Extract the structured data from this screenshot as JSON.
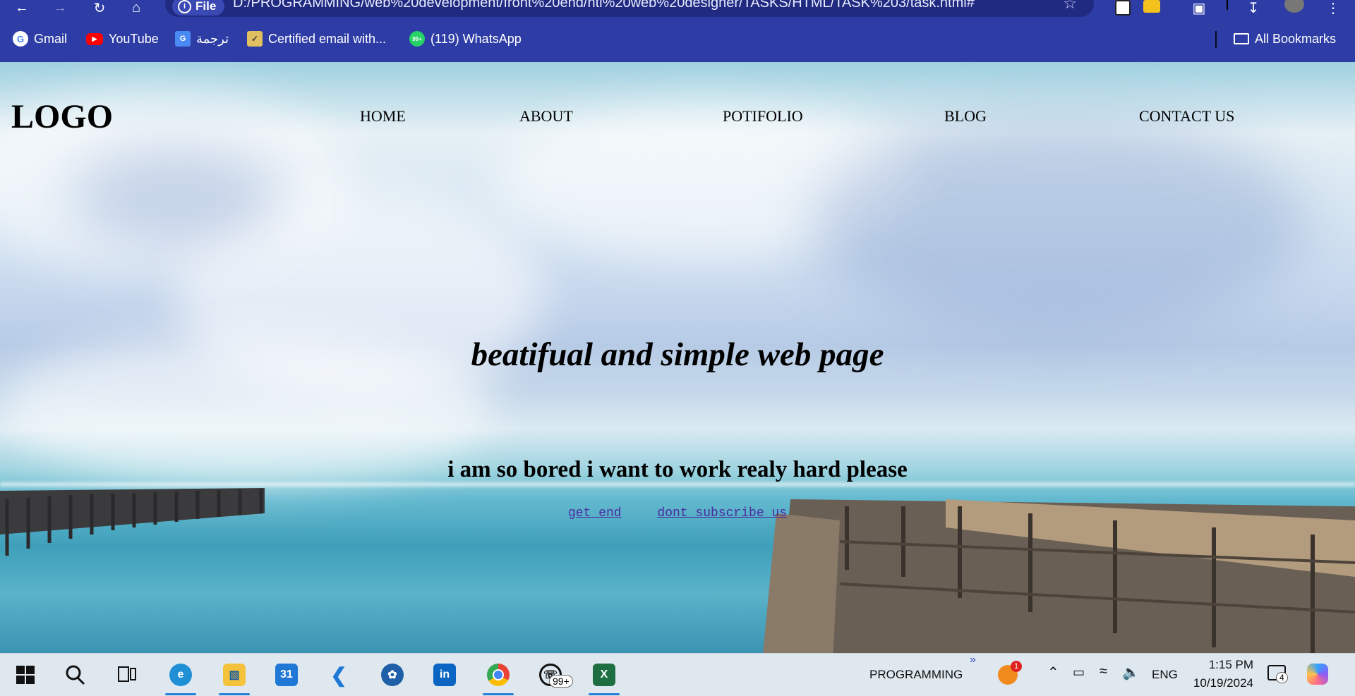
{
  "browser": {
    "url": "D:/PROGRAMMING/web%20development/front%20end/htl%20web%20designer/TASKS/HTML/TASK%203/task.html#",
    "file_chip_label": "File",
    "bookmarks": [
      {
        "label": "Gmail",
        "icon": "google-icon"
      },
      {
        "label": "YouTube",
        "icon": "youtube-icon"
      },
      {
        "label": "ترجمة",
        "icon": "translate-icon"
      },
      {
        "label": "Certified email with...",
        "icon": "certified-email-icon"
      },
      {
        "label": "(119) WhatsApp",
        "icon": "whatsapp-icon"
      }
    ],
    "all_bookmarks_label": "All Bookmarks",
    "whatsapp_badge": "99+"
  },
  "page": {
    "logo": "LOGO",
    "nav": [
      "HOME",
      "ABOUT",
      "POTIFOLIO",
      "BLOG",
      "CONTACT US"
    ],
    "headline": "beatifual and simple web page",
    "subheadline": "i am so bored i want to work realy hard please",
    "links": [
      "get end",
      "dont subscribe us"
    ]
  },
  "taskbar": {
    "folder_label": "PROGRAMMING",
    "notification_count": "1",
    "language": "ENG",
    "time": "1:15 PM",
    "date": "10/19/2024",
    "chat_count": "4",
    "whatsapp_badge": "99+",
    "calendar_day": "31"
  },
  "colors": {
    "chrome": "#2e3da6",
    "link": "#4b2aa0",
    "taskbar": "#dfe8ef"
  }
}
